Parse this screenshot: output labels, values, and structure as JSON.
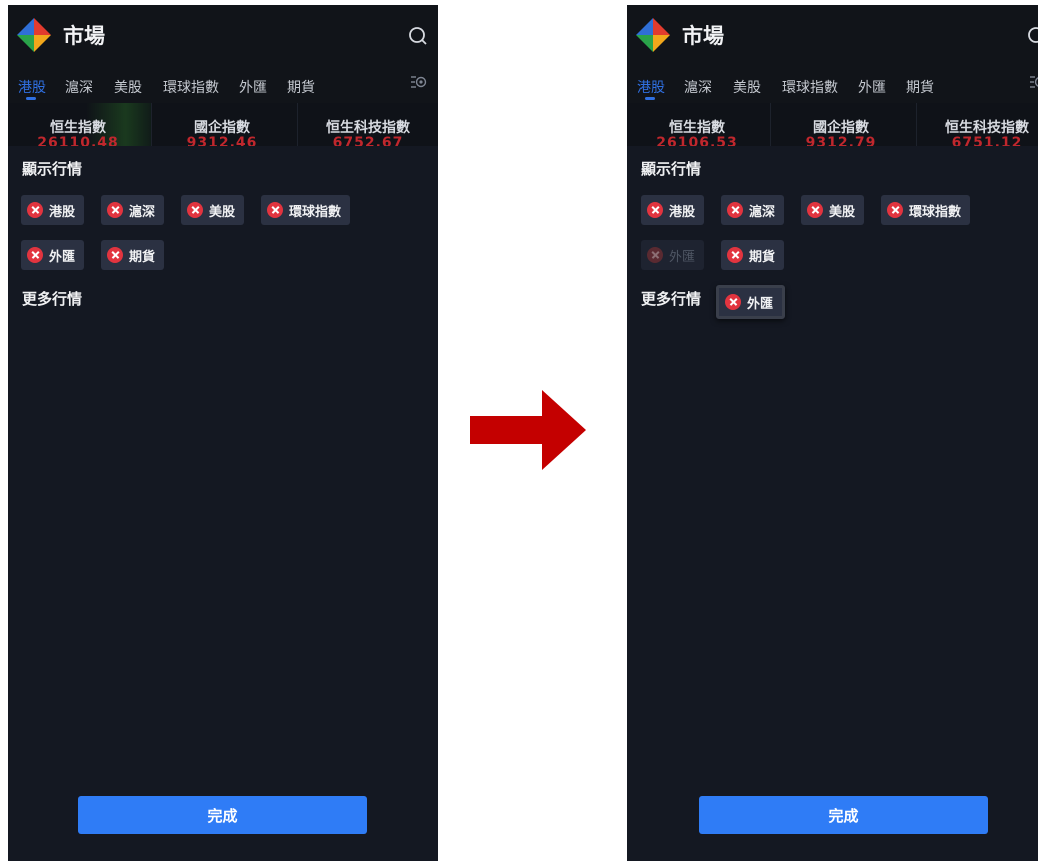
{
  "before": {
    "header": {
      "title": "市場"
    },
    "tabs": [
      "港股",
      "滬深",
      "美股",
      "環球指數",
      "外匯",
      "期貨"
    ],
    "active_tab": "港股",
    "indices": [
      {
        "name": "恒生指數",
        "value": "26110.48"
      },
      {
        "name": "國企指數",
        "value": "9312.46"
      },
      {
        "name": "恒生科技指數",
        "value": "6752.67"
      }
    ],
    "displayed_section": {
      "title": "顯示行情",
      "chips": [
        "港股",
        "滬深",
        "美股",
        "環球指數",
        "外匯",
        "期貨"
      ]
    },
    "more_section": {
      "title": "更多行情"
    },
    "done_button": "完成"
  },
  "after": {
    "header": {
      "title": "市場"
    },
    "tabs": [
      "港股",
      "滬深",
      "美股",
      "環球指數",
      "外匯",
      "期貨"
    ],
    "active_tab": "港股",
    "indices": [
      {
        "name": "恒生指數",
        "value": "26106.53"
      },
      {
        "name": "國企指數",
        "value": "9312.79"
      },
      {
        "name": "恒生科技指數",
        "value": "6751.12"
      }
    ],
    "displayed_section": {
      "title": "顯示行情",
      "chips": [
        "港股",
        "滬深",
        "美股",
        "環球指數",
        "外匯",
        "期貨"
      ],
      "ghost_chip": "外匯"
    },
    "more_section": {
      "title": "更多行情"
    },
    "dragging_chip": "外匯",
    "done_button": "完成"
  },
  "colors": {
    "background": "#141822",
    "accent": "#2f7cf6",
    "remove": "#e2343f",
    "price_down": "#c0272d",
    "arrow": "#c40000"
  },
  "icons": [
    "logo-icon",
    "search-icon",
    "tab-settings-icon",
    "remove-icon",
    "right-arrow-icon"
  ]
}
